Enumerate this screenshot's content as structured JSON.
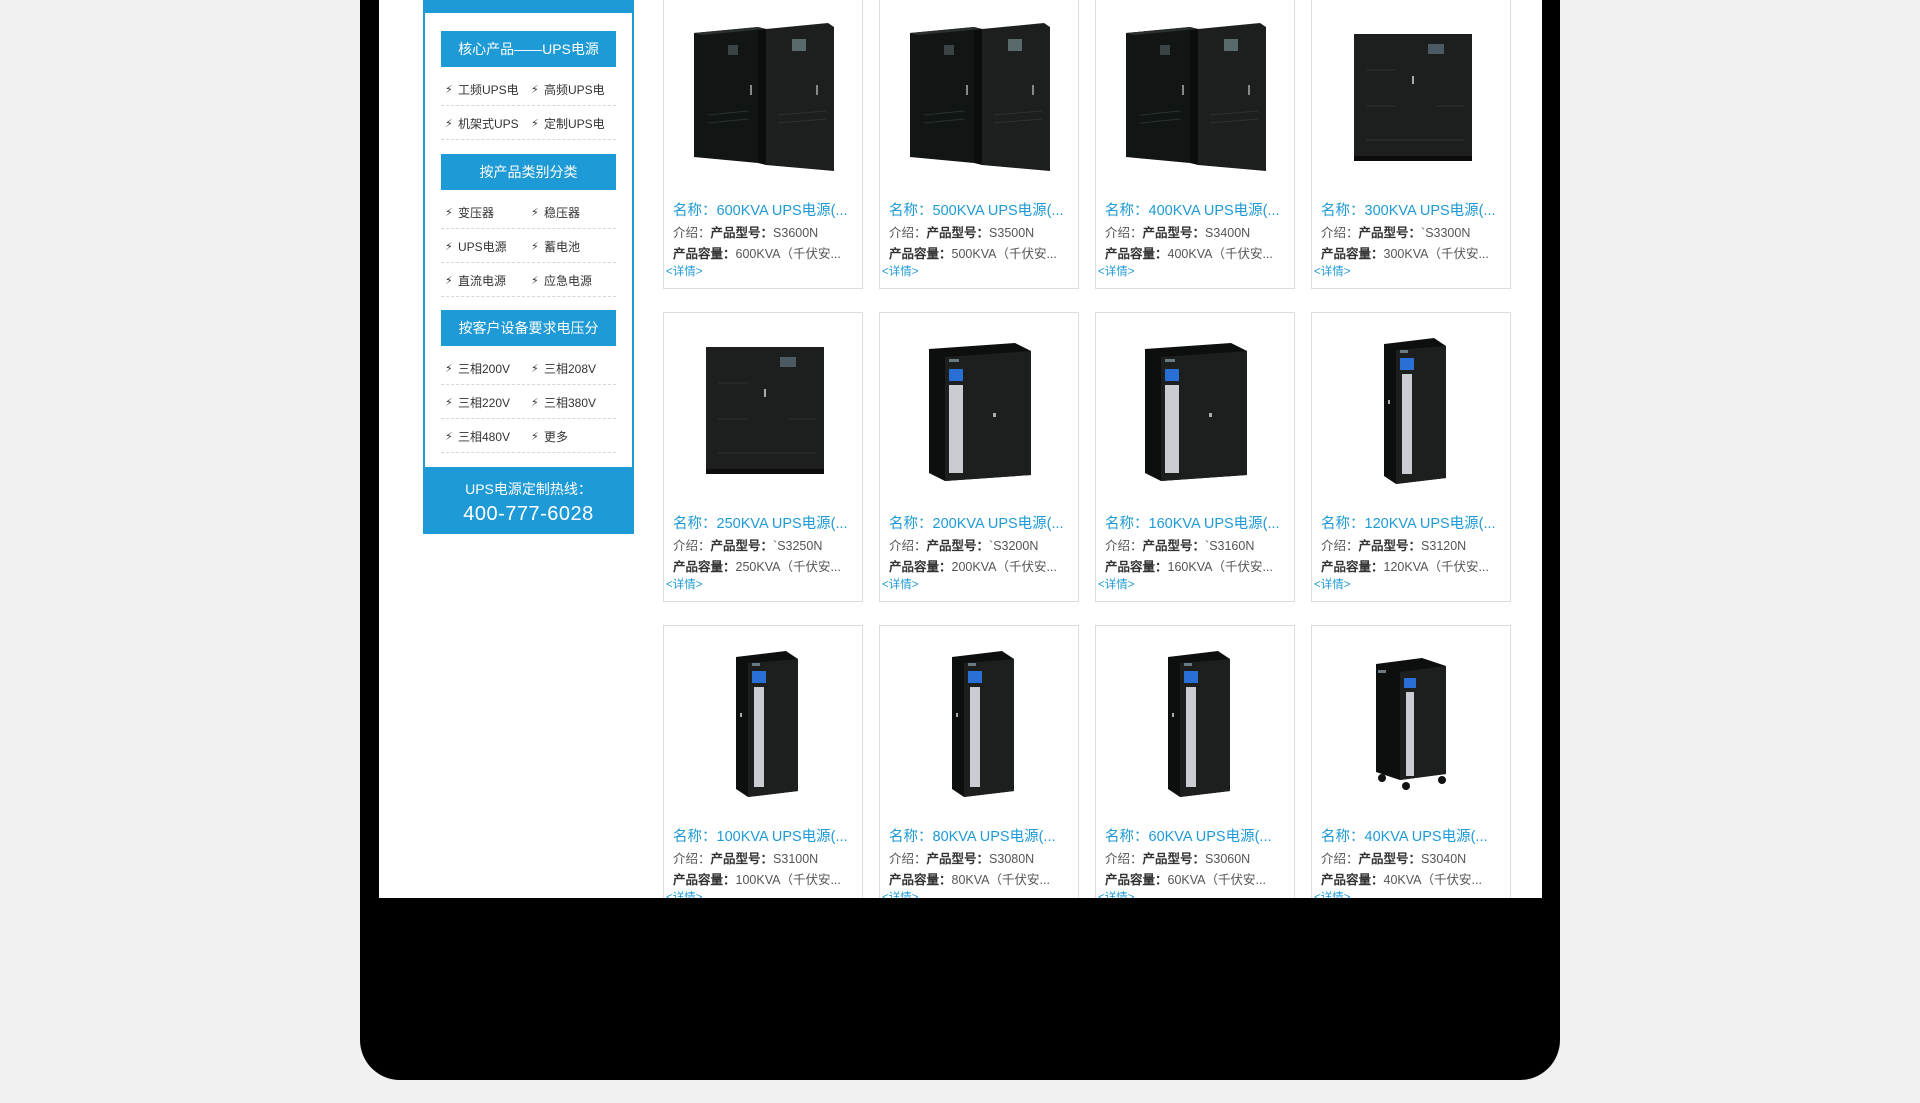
{
  "sidebar": {
    "sections": [
      {
        "heading": "核心产品——UPS电源",
        "rows": [
          [
            "工频UPS电",
            "高频UPS电"
          ],
          [
            "机架式UPS",
            "定制UPS电"
          ]
        ]
      },
      {
        "heading": "按产品类别分类",
        "rows": [
          [
            "变压器",
            "稳压器"
          ],
          [
            "UPS电源",
            "蓄电池"
          ],
          [
            "直流电源",
            "应急电源"
          ]
        ]
      },
      {
        "heading": "按客户设备要求电压分",
        "rows": [
          [
            "三相200V",
            "三相208V"
          ],
          [
            "三相220V",
            "三相380V"
          ],
          [
            "三相480V",
            "更多"
          ]
        ]
      }
    ],
    "hotline_label": "UPS电源定制热线：",
    "hotline_number": "400-777-6028"
  },
  "labels": {
    "intro_prefix": "介绍：",
    "model_label": "产品型号：",
    "capacity_label": "产品容量：",
    "more": "<详情>",
    "bolt": "⚡"
  },
  "products": [
    {
      "name": "名称：600KVA UPS电源(...",
      "model": "S3600N",
      "capacity": "600KVA（千伏安...",
      "style": "double-tall"
    },
    {
      "name": "名称：500KVA UPS电源(...",
      "model": "S3500N",
      "capacity": "500KVA（千伏安...",
      "style": "double-tall"
    },
    {
      "name": "名称：400KVA UPS电源(...",
      "model": "S3400N",
      "capacity": "400KVA（千伏安...",
      "style": "double-tall"
    },
    {
      "name": "名称：300KVA UPS电源(...",
      "model": "`S3300N",
      "capacity": "300KVA（千伏安...",
      "style": "wide-flat"
    },
    {
      "name": "名称：250KVA UPS电源(...",
      "model": "`S3250N",
      "capacity": "250KVA（千伏安...",
      "style": "wide-flat"
    },
    {
      "name": "名称：200KVA UPS电源(...",
      "model": "`S3200N",
      "capacity": "200KVA（千伏安...",
      "style": "wide-door"
    },
    {
      "name": "名称：160KVA UPS电源(...",
      "model": "`S3160N",
      "capacity": "160KVA（千伏安...",
      "style": "wide-door"
    },
    {
      "name": "名称：120KVA UPS电源(...",
      "model": "S3120N",
      "capacity": "120KVA（千伏安...",
      "style": "tower"
    },
    {
      "name": "名称：100KVA UPS电源(...",
      "model": "S3100N",
      "capacity": "100KVA（千伏安...",
      "style": "tower"
    },
    {
      "name": "名称：80KVA UPS电源(...",
      "model": "S3080N",
      "capacity": "80KVA（千伏安...",
      "style": "tower"
    },
    {
      "name": "名称：60KVA UPS电源(...",
      "model": "S3060N",
      "capacity": "60KVA（千伏安...",
      "style": "tower"
    },
    {
      "name": "名称：40KVA UPS电源(...",
      "model": "S3040N",
      "capacity": "40KVA（千伏安...",
      "style": "tower-wheels"
    }
  ],
  "colors": {
    "accent": "#1e9ad6",
    "frame": "#000000",
    "page_bg": "#f1f1f1",
    "cabinet": "#1d1f1f",
    "cabinet_screen": "#2a6fd6"
  }
}
